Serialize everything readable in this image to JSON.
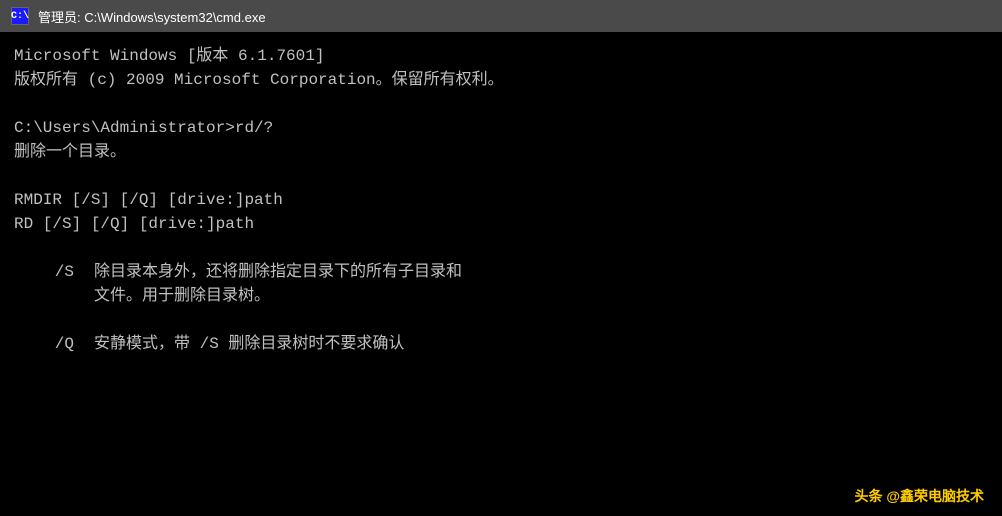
{
  "titlebar": {
    "icon_label": "C:\\",
    "title": "管理员: C:\\Windows\\system32\\cmd.exe"
  },
  "terminal": {
    "lines": [
      {
        "id": "line1",
        "text": "Microsoft Windows [版本 6.1.7601]"
      },
      {
        "id": "line2",
        "text": "版权所有 (c) 2009 Microsoft Corporation。保留所有权利。"
      },
      {
        "id": "line3",
        "text": ""
      },
      {
        "id": "line4",
        "text": "C:\\Users\\Administrator>rd/?"
      },
      {
        "id": "line5",
        "text": "删除一个目录。"
      },
      {
        "id": "line6",
        "text": ""
      },
      {
        "id": "line7",
        "text": "RMDIR [/S] [/Q] [drive:]path"
      },
      {
        "id": "line8",
        "text": "RD [/S] [/Q] [drive:]path"
      },
      {
        "id": "line9",
        "text": ""
      },
      {
        "id": "line10-s-label",
        "text": "/S"
      },
      {
        "id": "line10-s-desc1",
        "text": "除目录本身外，还将删除指定目录下的所有子目录和"
      },
      {
        "id": "line10-s-desc2",
        "text": "文件。用于删除目录树。"
      },
      {
        "id": "line11",
        "text": ""
      },
      {
        "id": "line12-q-label",
        "text": "/Q"
      },
      {
        "id": "line12-q-desc",
        "text": "安静模式，带 /S 删除目录树时不要求确认"
      }
    ],
    "watermark": "头条 @鑫荣电脑技术"
  }
}
